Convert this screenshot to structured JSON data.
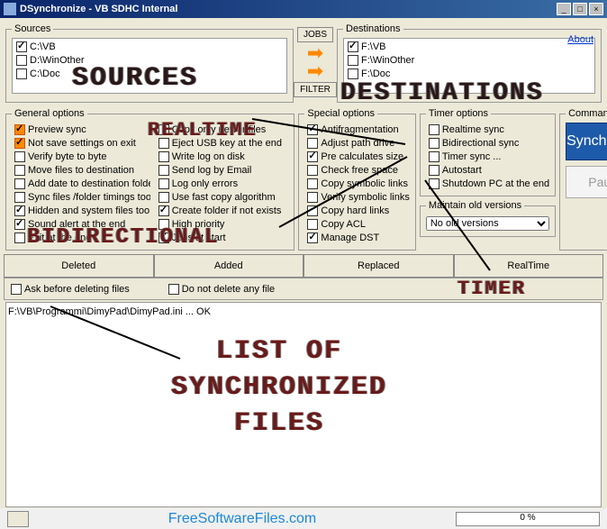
{
  "window": {
    "title": "DSynchronize - VB SDHC Internal",
    "min": "_",
    "max": "□",
    "close": "×"
  },
  "about": "About",
  "sources": {
    "legend": "Sources",
    "items": [
      {
        "path": "C:\\VB",
        "checked": true
      },
      {
        "path": "D:\\WinOther",
        "checked": false
      },
      {
        "path": "C:\\Doc",
        "checked": false
      }
    ]
  },
  "destinations": {
    "legend": "Destinations",
    "items": [
      {
        "path": "F:\\VB",
        "checked": true
      },
      {
        "path": "F:\\WinOther",
        "checked": false
      },
      {
        "path": "F:\\Doc",
        "checked": false
      }
    ]
  },
  "midbuttons": {
    "jobs": "JOBS",
    "filter": "FILTER"
  },
  "general": {
    "legend": "General options",
    "col1": [
      {
        "label": "Preview sync",
        "checked": true,
        "orange": true
      },
      {
        "label": "Not save settings on exit",
        "checked": true,
        "orange": true
      },
      {
        "label": "Verify byte to byte",
        "checked": false
      },
      {
        "label": "Move files to destination",
        "checked": false
      },
      {
        "label": "Add date to destination folder",
        "checked": false
      },
      {
        "label": "Sync files /folder timings too",
        "checked": false
      },
      {
        "label": "Hidden and system files too",
        "checked": true
      },
      {
        "label": "Sound alert at the end",
        "checked": true
      },
      {
        "label": "Exit at the end",
        "checked": false
      }
    ],
    "col2": [
      {
        "label": "Copy only newer files",
        "checked": false
      },
      {
        "label": "Eject USB key at the end",
        "checked": false
      },
      {
        "label": "Write log on disk",
        "checked": false
      },
      {
        "label": "Send log by Email",
        "checked": false
      },
      {
        "label": "Log only errors",
        "checked": false
      },
      {
        "label": "Use fast copy algorithm",
        "checked": false
      },
      {
        "label": "Create folder if not exists",
        "checked": true
      },
      {
        "label": "High priority",
        "checked": false
      },
      {
        "label": "Jobs at start",
        "checked": true
      }
    ]
  },
  "special": {
    "legend": "Special options",
    "items": [
      {
        "label": "Antifragmentation",
        "checked": true
      },
      {
        "label": "Adjust path drive",
        "checked": false
      },
      {
        "label": "Pre calculates size",
        "checked": true
      },
      {
        "label": "Check free space",
        "checked": false
      },
      {
        "label": "Copy symbolic links",
        "checked": false
      },
      {
        "label": "Verify symbolic links",
        "checked": false
      },
      {
        "label": "Copy hard links",
        "checked": false
      },
      {
        "label": "Copy ACL",
        "checked": false
      },
      {
        "label": "Manage DST",
        "checked": true
      }
    ]
  },
  "timer": {
    "legend": "Timer options",
    "items": [
      {
        "label": "Realtime sync",
        "checked": false
      },
      {
        "label": "Bidirectional sync",
        "checked": false
      },
      {
        "label": "Timer sync ...",
        "checked": false
      },
      {
        "label": "Autostart",
        "checked": false
      },
      {
        "label": "Shutdown PC at the end",
        "checked": false
      }
    ]
  },
  "maintain": {
    "legend": "Maintain old versions",
    "value": "No old versions"
  },
  "commands": {
    "legend": "Commands",
    "sync": "Synchronize",
    "pause": "Pause"
  },
  "tabs": {
    "deleted": "Deleted",
    "added": "Added",
    "replaced": "Replaced",
    "realtime": "RealTime"
  },
  "subopts": {
    "ask": "Ask before deleting files",
    "dont": "Do not delete any file"
  },
  "log": {
    "line1": "F:\\VB\\Programmi\\DimyPad\\DimyPad.ini ... OK"
  },
  "footer": {
    "watermark": "FreeSoftwareFiles.com",
    "progress": "0 %"
  },
  "anno": {
    "sources": "SOURCES",
    "destinations": "DESTINATIONS",
    "realtime": "REALTIME",
    "bidirectional": "BIDIRECTIONAL",
    "timer": "TIMER",
    "list": "LIST OF\nSYNCHRONIZED\nFILES"
  }
}
